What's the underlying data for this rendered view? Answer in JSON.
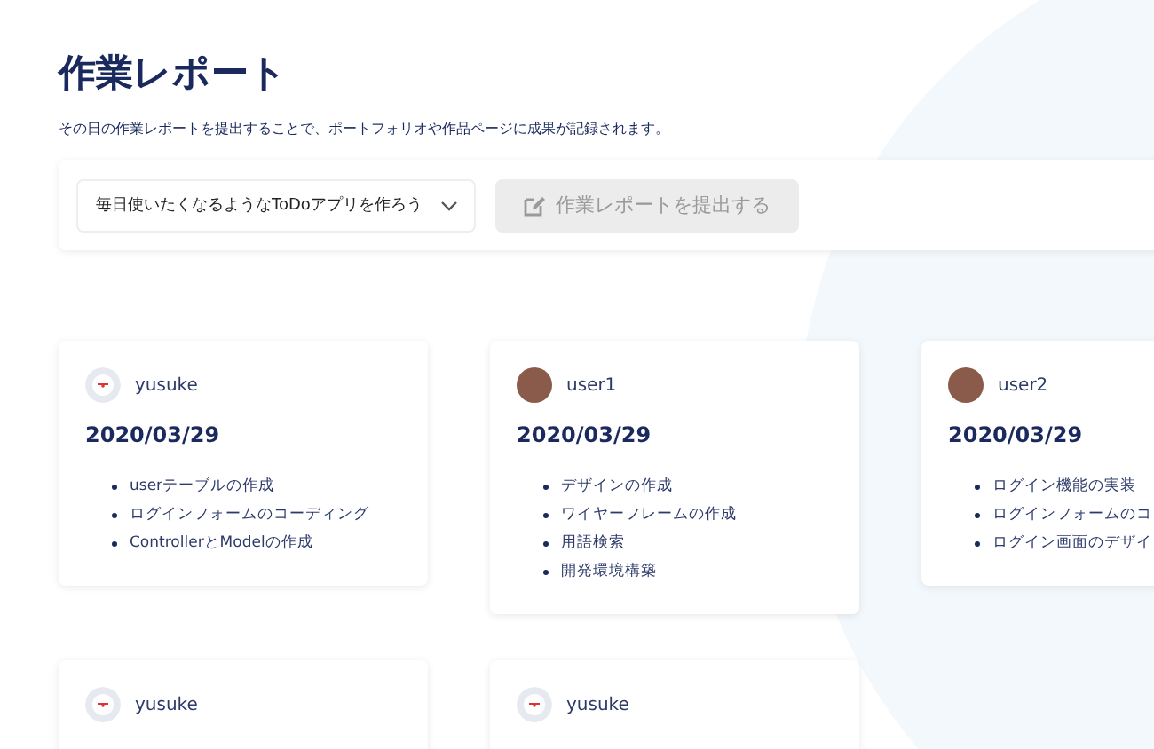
{
  "page": {
    "title": "作業レポート",
    "description": "その日の作業レポートを提出することで、ポートフォリオや作品ページに成果が記録されます。"
  },
  "toolbar": {
    "project_select": {
      "value": "毎日使いたくなるようなToDoアプリを作ろう"
    },
    "submit_button": {
      "label": "作業レポートを提出する",
      "disabled": true
    }
  },
  "reports": [
    {
      "user": "yusuke",
      "photo_avatar": false,
      "date": "2020/03/29",
      "items": [
        "userテーブルの作成",
        "ログインフォームのコーディング",
        "ControllerとModelの作成"
      ]
    },
    {
      "user": "user1",
      "photo_avatar": true,
      "date": "2020/03/29",
      "items": [
        "デザインの作成",
        "ワイヤーフレームの作成",
        "用語検索",
        "開発環境構築"
      ]
    },
    {
      "user": "user2",
      "photo_avatar": true,
      "date": "2020/03/29",
      "items": [
        "ログイン機能の実装",
        "ログインフォームのコ",
        "ログイン画面のデザイ"
      ]
    },
    {
      "user": "yusuke",
      "photo_avatar": false
    },
    {
      "user": "yusuke",
      "photo_avatar": false
    }
  ]
}
